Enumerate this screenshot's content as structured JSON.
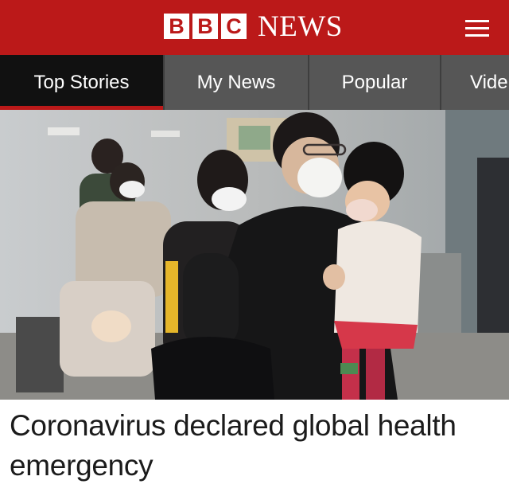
{
  "header": {
    "logo_letters": [
      "B",
      "B",
      "C"
    ],
    "logo_news": "NEWS",
    "menu_icon": "hamburger-menu-icon",
    "brand_color": "#bb1919"
  },
  "nav": {
    "tabs": [
      {
        "label": "Top Stories",
        "active": true
      },
      {
        "label": "My News",
        "active": false
      },
      {
        "label": "Popular",
        "active": false
      },
      {
        "label": "Vide",
        "active": false
      }
    ],
    "active_indicator_color": "#bb1919"
  },
  "story": {
    "headline": "Coronavirus declared global health emergency"
  }
}
